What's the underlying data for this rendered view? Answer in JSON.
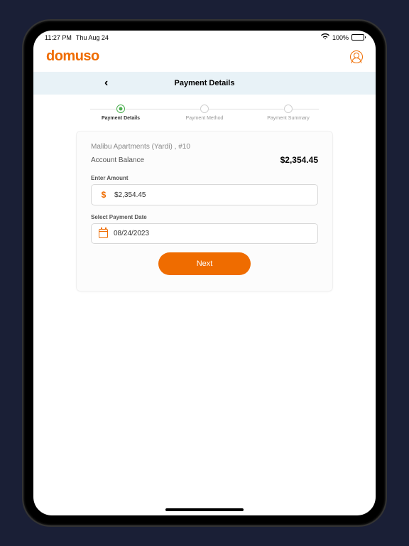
{
  "statusBar": {
    "time": "11:27 PM",
    "date": "Thu Aug 24",
    "battery": "100%"
  },
  "header": {
    "logo": "domuso"
  },
  "pageHeader": {
    "title": "Payment Details",
    "backIcon": "‹"
  },
  "stepper": {
    "steps": [
      {
        "label": "Payment Details",
        "active": true
      },
      {
        "label": "Payment Method",
        "active": false
      },
      {
        "label": "Payment Summary",
        "active": false
      }
    ]
  },
  "card": {
    "propertyName": "Malibu Apartments (Yardi) , #10",
    "balanceLabel": "Account Balance",
    "balanceAmount": "$2,354.45",
    "amountLabel": "Enter Amount",
    "amountValue": "$2,354.45",
    "dollarSign": "$",
    "dateLabel": "Select Payment Date",
    "dateValue": "08/24/2023",
    "nextButton": "Next"
  }
}
